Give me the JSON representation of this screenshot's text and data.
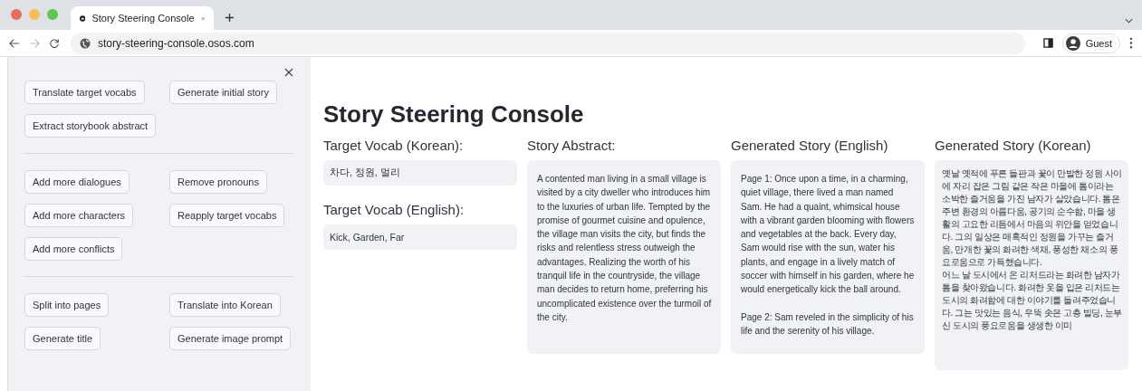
{
  "browser": {
    "tab_title": "Story Steering Console",
    "url": "story-steering-console.osos.com",
    "profile": "Guest"
  },
  "sidebar": {
    "groups": [
      {
        "buttons": [
          "Translate target vocabs",
          "Generate initial story",
          "Extract storybook abstract"
        ]
      },
      {
        "buttons": [
          "Add more dialogues",
          "Remove pronouns",
          "Add more characters",
          "Reapply target vocabs",
          "Add more conflicts"
        ]
      },
      {
        "buttons": [
          "Split into pages",
          "Translate into Korean",
          "Generate title",
          "Generate image prompt"
        ]
      }
    ]
  },
  "main": {
    "title": "Story Steering Console",
    "vocab": [
      {
        "label": "Target Vocab (Korean):",
        "value": "차다, 정원, 멀리"
      },
      {
        "label": "Target Vocab (English):",
        "value": "Kick, Garden, Far"
      }
    ],
    "areas": [
      {
        "label": "Story Abstract:",
        "text": "A contented man living in a small village is visited by a city dweller who introduces him to the luxuries of urban life. Tempted by the promise of gourmet cuisine and opulence, the village man visits the city, but finds the risks and relentless stress outweigh the advantages. Realizing the worth of his tranquil life in the countryside, the village man decides to return home, preferring his uncomplicated existence over the turmoil of the city."
      },
      {
        "label": "Generated Story (English)",
        "text": "Page 1: Once upon a time, in a charming, quiet village, there lived a man named Sam. He had a quaint, whimsical house with a vibrant garden blooming with flowers and vegetables at the back. Every day, Sam would rise with the sun, water his plants, and engage in a lively match of soccer with himself in his garden, where he would energetically kick the ball around.\n\nPage 2: Sam reveled in the simplicity of his life and the serenity of his village."
      },
      {
        "label": "Generated Story (Korean)",
        "text": "옛날 옛적에 푸른 들판과 꽃이 만발한 정원 사이에 자리 잡은 그림 같은 작은 마을에 톰이라는 소박한 즐거움을 가진 남자가 살았습니다. 톰은 주변 환경의 아름다움, 공기의 순수함, 마을 생활의 고요한 리듬에서 마음의 위안을 얻었습니다. 그의 일상은 매혹적인 정원을 가꾸는 즐거움, 만개한 꽃의 화려한 색채, 풍성한 채소의 풍요로움으로 가득했습니다.\n어느 날 도시에서 온 리처드라는 화려한 남자가 톰을 찾아왔습니다. 화려한 옷을 입은 리처드는 도시의 화려함에 대한 이야기를 들려주었습니다. 그는 맛있는 음식, 우뚝 솟은 고층 빌딩, 눈부신 도시의 풍요로움을 생생한 이미"
      }
    ]
  }
}
